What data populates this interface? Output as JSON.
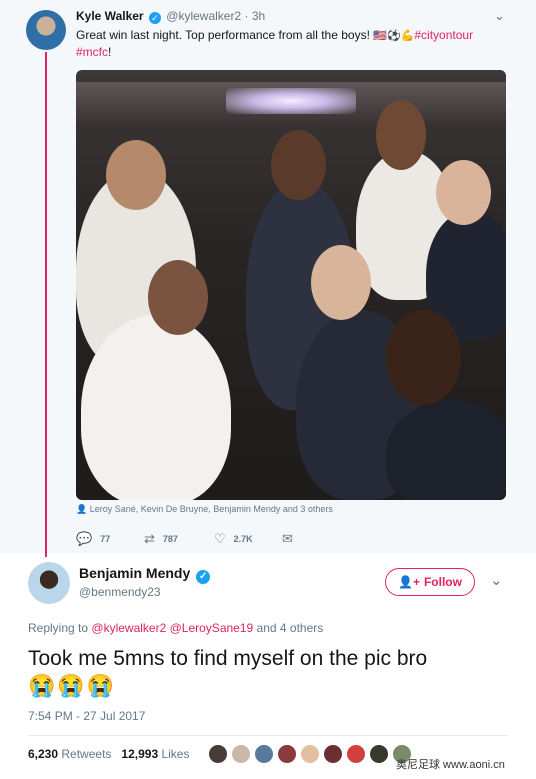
{
  "parent_tweet": {
    "name": "Kyle Walker",
    "handle": "@kylewalker2",
    "time": "· 3h",
    "text": "Great win last night. Top performance from all the boys!",
    "emojis": "🇺🇸⚽💪",
    "hashtag_1": "#cityontour",
    "hashtag_2": "#mcfc",
    "text_end": "!",
    "tagged": "Leroy Sané, Kevin De Bruyne, Benjamin Mendy and 3 others",
    "replies": "77",
    "retweets": "787",
    "likes": "2.7K"
  },
  "main_tweet": {
    "name": "Benjamin Mendy",
    "handle": "@benmendy23",
    "follow_label": "Follow",
    "replying_prefix": "Replying to",
    "mention_1": "@kylewalker2",
    "mention_2": "@LeroySane19",
    "replying_suffix": "and 4 others",
    "text": "Took me 5mns to find myself on the pic bro",
    "emojis": "😭😭😭",
    "timestamp": "7:54 PM - 27 Jul 2017",
    "retweets_count": "6,230",
    "retweets_label": "Retweets",
    "likes_count": "12,993",
    "likes_label": "Likes"
  },
  "watermark": "奥尼足球 www.aoni.cn",
  "colors": {
    "accent": "#e0245e",
    "verified": "#1da1f2",
    "muted": "#657786"
  },
  "icons": [
    "verified-icon",
    "chevron-down-icon",
    "reply-icon",
    "retweet-icon",
    "like-icon",
    "dm-icon",
    "person-icon",
    "follow-person-icon"
  ]
}
